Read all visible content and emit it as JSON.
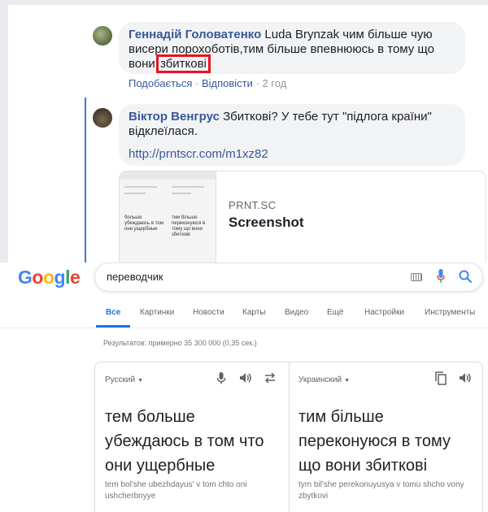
{
  "facebook": {
    "comment1": {
      "author": "Геннадій Головатенко",
      "text_before": " Luda Brynzak чим більше чую висери порохоботів,тим більше впевнююсь в тому що вони ",
      "highlighted_word": "збиткові",
      "like_label": "Подобається",
      "separator1": " · ",
      "reply_label": "Відповісти",
      "separator2": " · ",
      "time": "2 год"
    },
    "comment2": {
      "author": "Віктор Венгрус",
      "text": " Збиткові? У тебе тут \"підлога країни\" відклеїлася.",
      "link": "http://prntscr.com/m1xz82"
    },
    "link_preview": {
      "domain": "PRNT.SC",
      "title": "Screenshot",
      "thumb_left_text": "больше убеждаюсь в том они ущербные",
      "thumb_right_text": "тим більше переконуюся в тому що вони збиткові"
    },
    "highlight_color": "#e8141c",
    "link_color": "#385898"
  },
  "google": {
    "logo_letters": [
      "G",
      "o",
      "o",
      "g",
      "l",
      "e"
    ],
    "logo_colors": [
      "#4285f4",
      "#ea4335",
      "#fbbc05",
      "#4285f4",
      "#34a853",
      "#ea4335"
    ],
    "search_query": "переводчик",
    "tabs": [
      "Все",
      "Картинки",
      "Новости",
      "Карты",
      "Видео",
      "Ещё",
      "Настройки",
      "Инструменты"
    ],
    "active_tab": "Все",
    "result_stats": "Результатов: примерно 35 300 000 (0,35 сек.)",
    "translator": {
      "source_lang": "Русский",
      "target_lang": "Украинский",
      "source_text": "тем больше убеждаюсь в том что они ущербные",
      "target_text": "тим більше переконуюся в тому що вони збиткові",
      "source_translit": "tem bol'she ubezhdayus' v tom chto oni ushcherbnyye",
      "target_translit": "tym bil'she perekonuyusya v tomu shcho vony zbytkovi"
    },
    "accent_color": "#1a73e8"
  }
}
